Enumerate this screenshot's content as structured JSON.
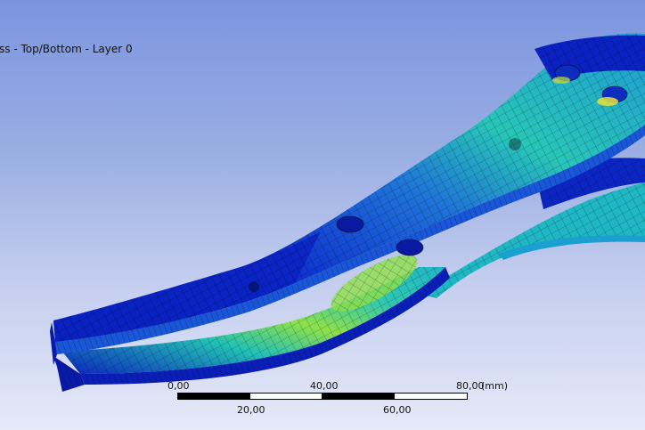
{
  "viewport": {
    "result_label": "ss - Top/Bottom - Layer 0"
  },
  "scale_bar": {
    "top_ticks": [
      "0,00",
      "40,00",
      "80,00"
    ],
    "unit": "(mm)",
    "bottom_ticks": [
      "20,00",
      "60,00"
    ]
  },
  "colors": {
    "background_top": "#7b94df",
    "background_bottom": "#e6e9f8",
    "stress_low": "#0a1fb8",
    "stress_mid_low": "#1c6fe0",
    "stress_mid": "#1fc9c0",
    "stress_high": "#a8e83a",
    "stress_peak": "#e8e03a"
  },
  "icons": {
    "model": "fea-mesh-part"
  }
}
